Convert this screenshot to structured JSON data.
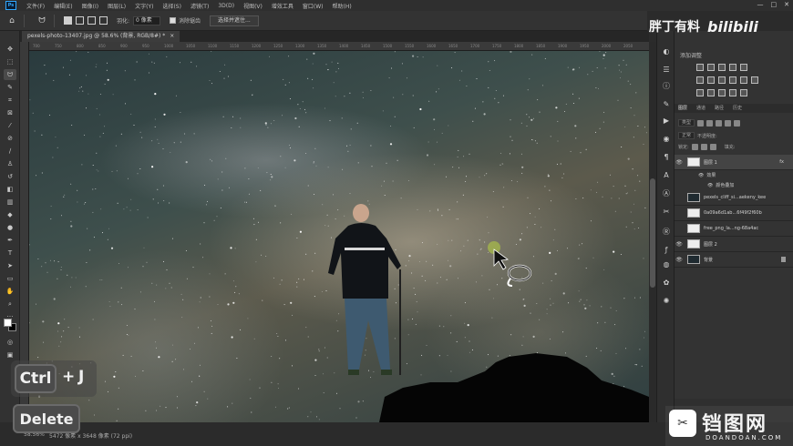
{
  "app": {
    "logo": "Ps"
  },
  "menu": [
    "文件(F)",
    "编辑(E)",
    "图像(I)",
    "图层(L)",
    "文字(Y)",
    "选择(S)",
    "滤镜(T)",
    "3D(D)",
    "视图(V)",
    "增效工具",
    "窗口(W)",
    "帮助(H)"
  ],
  "window_controls": {
    "minimize": "—",
    "maximize": "□",
    "close": "✕"
  },
  "options_bar": {
    "feather_label": "羽化:",
    "feather_value": "0 像素",
    "antialias_label": "消除锯齿",
    "select_mask_button": "选择并遮住..."
  },
  "document": {
    "tab_label": "pexels-photo-13407.jpg @ 58.6% (背景, RGB/8#) *",
    "close": "×"
  },
  "status": {
    "zoom": "58.56%",
    "doc_info": "5472 像素 x 3648 像素 (72 ppi)"
  },
  "ruler_ticks": [
    "700",
    "750",
    "800",
    "850",
    "900",
    "950",
    "1000",
    "1050",
    "1100",
    "1150",
    "1200",
    "1250",
    "1300",
    "1350",
    "1400",
    "1450",
    "1500",
    "1550",
    "1600",
    "1650",
    "1700",
    "1750",
    "1800",
    "1850",
    "1900",
    "1950",
    "2000",
    "2050"
  ],
  "overlay_keys": {
    "ctrl": "Ctrl",
    "plus": "+",
    "j": "J",
    "delete": "Delete"
  },
  "watermark_top": {
    "cn": "胖丁有料",
    "bili": "bilibili"
  },
  "watermark_bottom": {
    "logo": "✂",
    "site": "铛图网",
    "url": "DOANDOAN.COM"
  },
  "panels": {
    "adjustments_title": "添加调整",
    "tabs": [
      "图层",
      "通道",
      "路径",
      "历史"
    ],
    "kind_label": "类型",
    "blend_mode": "正常",
    "opacity_label": "不透明度:",
    "lock_label": "锁定:",
    "fill_label": "填充:",
    "layers": [
      {
        "name": "图层 1",
        "thumb": "white",
        "eye": "👁",
        "fx": "fx",
        "selected": true
      },
      {
        "name": "pexels_cliff_si...aekeny_kee",
        "thumb": "dark",
        "eye": ""
      },
      {
        "name": "0a09a6d1ab...6f49f2f60b",
        "thumb": "white",
        "eye": ""
      },
      {
        "name": "free_png_la...ng-68a4ac",
        "thumb": "white",
        "eye": ""
      },
      {
        "name": "图层 2",
        "thumb": "white",
        "eye": "👁"
      },
      {
        "name": "背景",
        "thumb": "dark",
        "eye": "👁",
        "lock": true
      }
    ],
    "effects_label": "效果",
    "effect_item": "颜色叠加"
  }
}
